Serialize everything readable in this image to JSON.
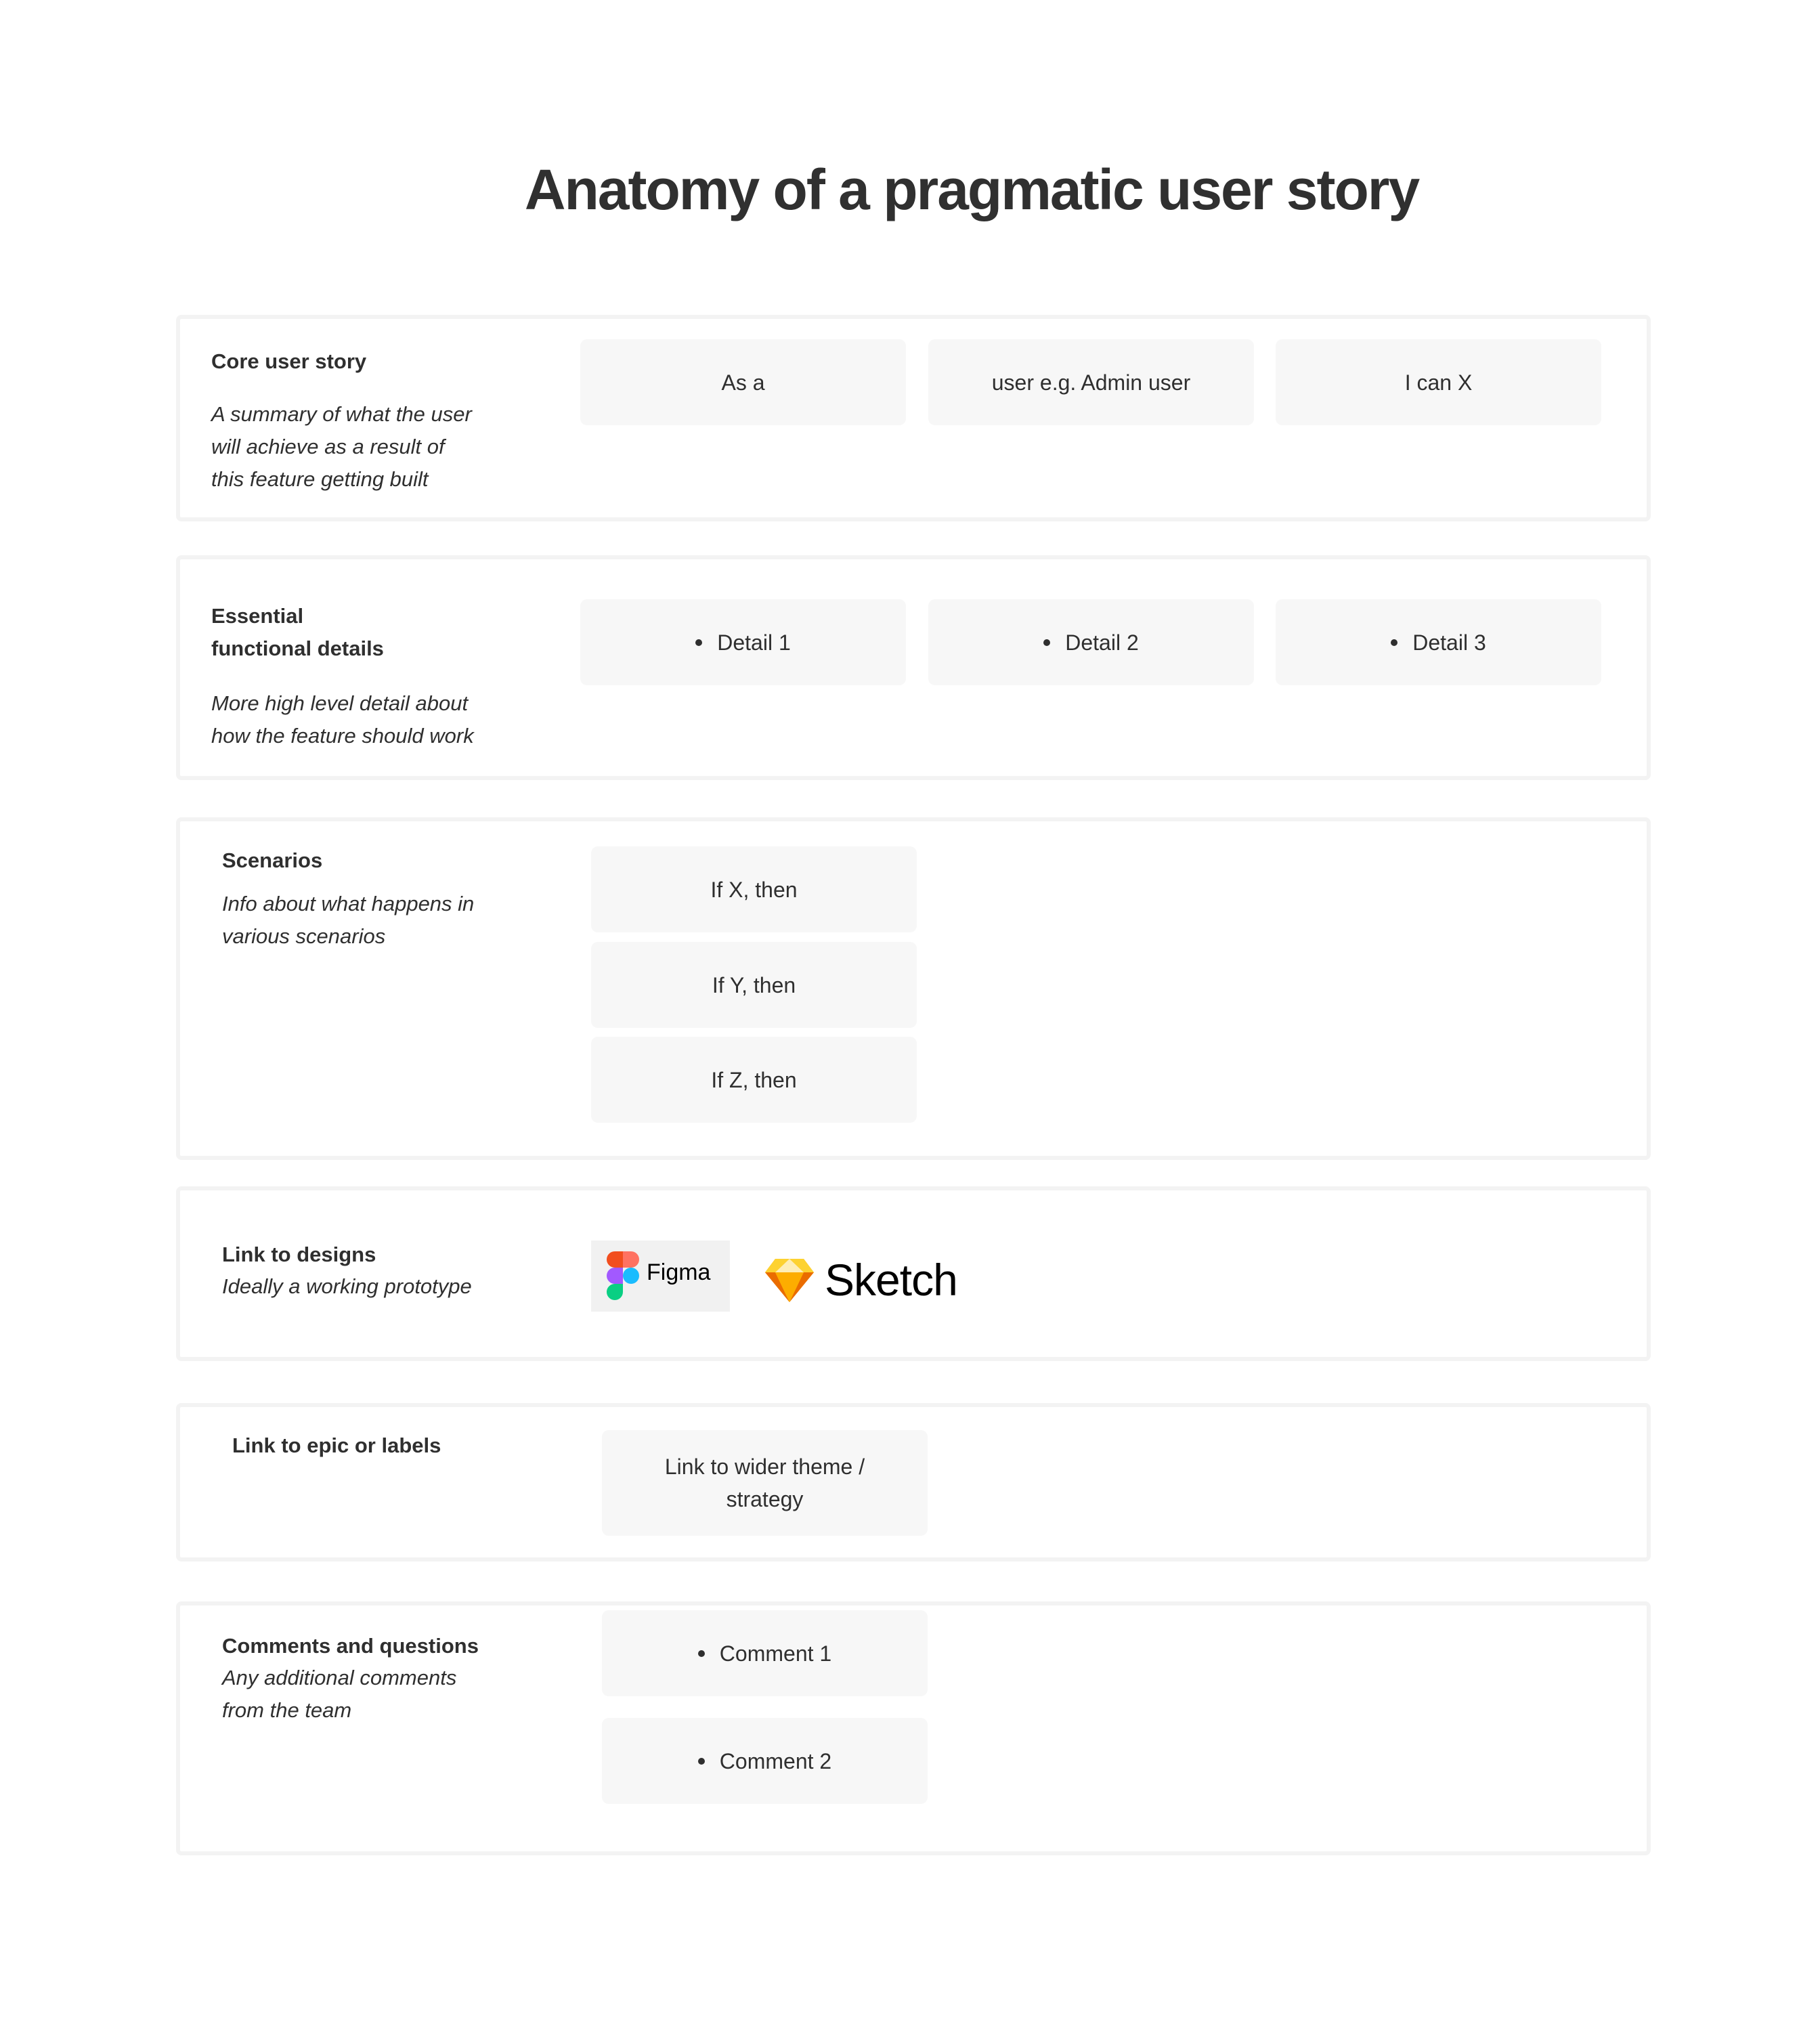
{
  "title": "Anatomy of a pragmatic user story",
  "sections": [
    {
      "label": "Core user story",
      "description": [
        "A summary of what the user",
        "will achieve as a result of",
        "this feature getting built"
      ],
      "cells": [
        "As a",
        "user e.g. Admin user",
        "I can X"
      ]
    },
    {
      "label": [
        "Essential",
        "functional details"
      ],
      "description": [
        "More high level detail about",
        "how the feature should work"
      ],
      "cells": [
        "Detail 1",
        "Detail 2",
        "Detail 3"
      ]
    },
    {
      "label": "Scenarios",
      "description": [
        "Info about what happens in",
        "various scenarios"
      ],
      "cells": [
        "If X, then",
        "If Y, then",
        "If Z, then"
      ]
    },
    {
      "label": "Link to designs",
      "description": [
        "Ideally a working prototype"
      ],
      "links": [
        {
          "name": "Figma",
          "icon": "figma-logo"
        },
        {
          "name": "Sketch",
          "icon": "sketch-logo"
        }
      ]
    },
    {
      "label": "Link to epic or labels",
      "cells": [
        "Link to wider theme /",
        "strategy"
      ]
    },
    {
      "label": "Comments and questions",
      "description": [
        "Any additional comments",
        "from the team"
      ],
      "cells": [
        "Comment 1",
        "Comment 2"
      ]
    }
  ],
  "colors": {
    "text": "#2f2f2f",
    "cell_bg": "#f7f7f7",
    "border": "#f3f3f3",
    "figma_red": "#f24e1e",
    "figma_salmon": "#ff7262",
    "figma_purple": "#a259ff",
    "figma_blue": "#1abcfe",
    "figma_green": "#0acf83",
    "sketch_yellow": "#fdb300"
  }
}
